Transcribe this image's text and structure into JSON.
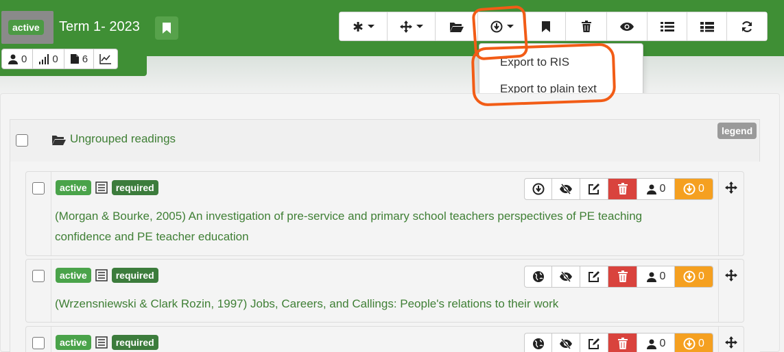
{
  "header": {
    "status_badge": "active",
    "term_title": "Term 1- 2023",
    "stats": [
      {
        "icon": "user-icon",
        "value": "0"
      },
      {
        "icon": "signal-bars-icon",
        "value": "0"
      },
      {
        "icon": "document-icon",
        "value": "6"
      },
      {
        "icon": "line-chart-icon",
        "value": ""
      }
    ]
  },
  "toolbar": {
    "buttons": [
      {
        "icon": "asterisk-icon",
        "dropdown": true
      },
      {
        "icon": "move-arrows-icon",
        "dropdown": true
      },
      {
        "icon": "folder-open-icon",
        "dropdown": false
      },
      {
        "icon": "download-circle-icon",
        "dropdown": true
      },
      {
        "icon": "bookmark-icon",
        "dropdown": false
      },
      {
        "icon": "trash-icon",
        "dropdown": false
      },
      {
        "icon": "eye-icon",
        "dropdown": false
      },
      {
        "icon": "list-icon",
        "dropdown": false
      },
      {
        "icon": "list-detail-icon",
        "dropdown": false
      },
      {
        "icon": "refresh-icon",
        "dropdown": false
      }
    ]
  },
  "export_menu": {
    "items": [
      "Export to RIS",
      "Export to plain text"
    ]
  },
  "group": {
    "label": "Ungrouped readings",
    "legend": "legend"
  },
  "readings": [
    {
      "status": "active",
      "required": "required",
      "title": "(Morgan & Bourke, 2005) An investigation of pre-service and primary school teachers perspectives of PE teaching confidence and PE teacher education",
      "first_action_icon": "download-circle-icon",
      "users_count": "0",
      "downloads_count": "0"
    },
    {
      "status": "active",
      "required": "required",
      "title": "(Wrzensniewski & Clark Rozin, 1997) Jobs, Careers, and Callings: People's relations to their work",
      "first_action_icon": "globe-icon",
      "users_count": "0",
      "downloads_count": "0"
    },
    {
      "status": "active",
      "required": "required",
      "title": "",
      "first_action_icon": "globe-icon",
      "users_count": "0",
      "downloads_count": "0"
    }
  ],
  "colors": {
    "header_green": "#3f8f35",
    "link_green": "#3f7f35",
    "active_badge": "#4aa34a",
    "required_badge": "#3c7c3c",
    "delete_red": "#d9433d",
    "download_orange": "#f5a020",
    "annotation_orange": "#f25c16"
  }
}
